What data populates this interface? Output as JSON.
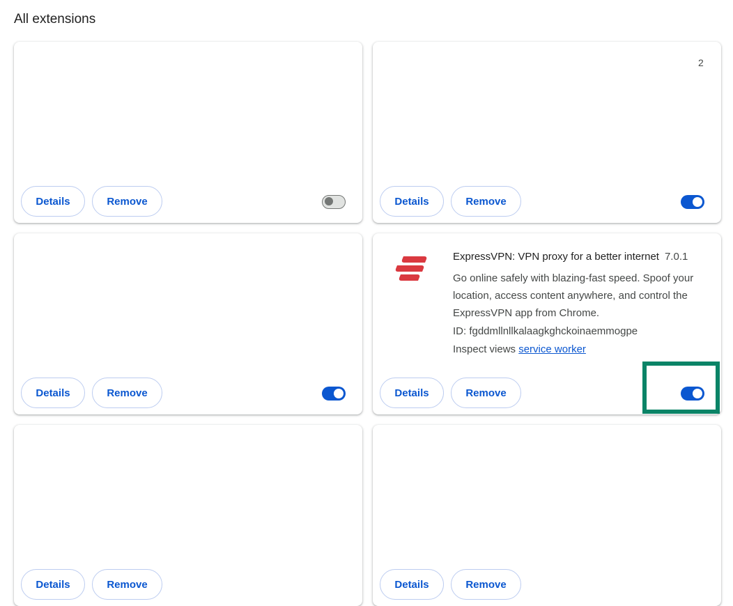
{
  "section_title": "All extensions",
  "cards": [
    {
      "details_label": "Details",
      "remove_label": "Remove",
      "enabled": false
    },
    {
      "details_label": "Details",
      "remove_label": "Remove",
      "enabled": true,
      "stray_glyph": "2"
    },
    {
      "details_label": "Details",
      "remove_label": "Remove",
      "enabled": true
    },
    {
      "name": "ExpressVPN: VPN proxy for a better internet",
      "version": "7.0.1",
      "description": "Go online safely with blazing-fast speed. Spoof your location, access content anywhere, and control the ExpressVPN app from Chrome.",
      "id_text": "ID: fgddmllnllkalaagkghckoinaemmogpe",
      "inspect_label": "Inspect views",
      "inspect_link": "service worker",
      "details_label": "Details",
      "remove_label": "Remove",
      "enabled": true,
      "logo_icon": "expressvpn-logo",
      "logo_color": "#da3940"
    },
    {
      "details_label": "Details",
      "remove_label": "Remove"
    },
    {
      "details_label": "Details",
      "remove_label": "Remove"
    }
  ],
  "colors": {
    "accent": "#0b57d0",
    "highlight": "#0b8467"
  }
}
